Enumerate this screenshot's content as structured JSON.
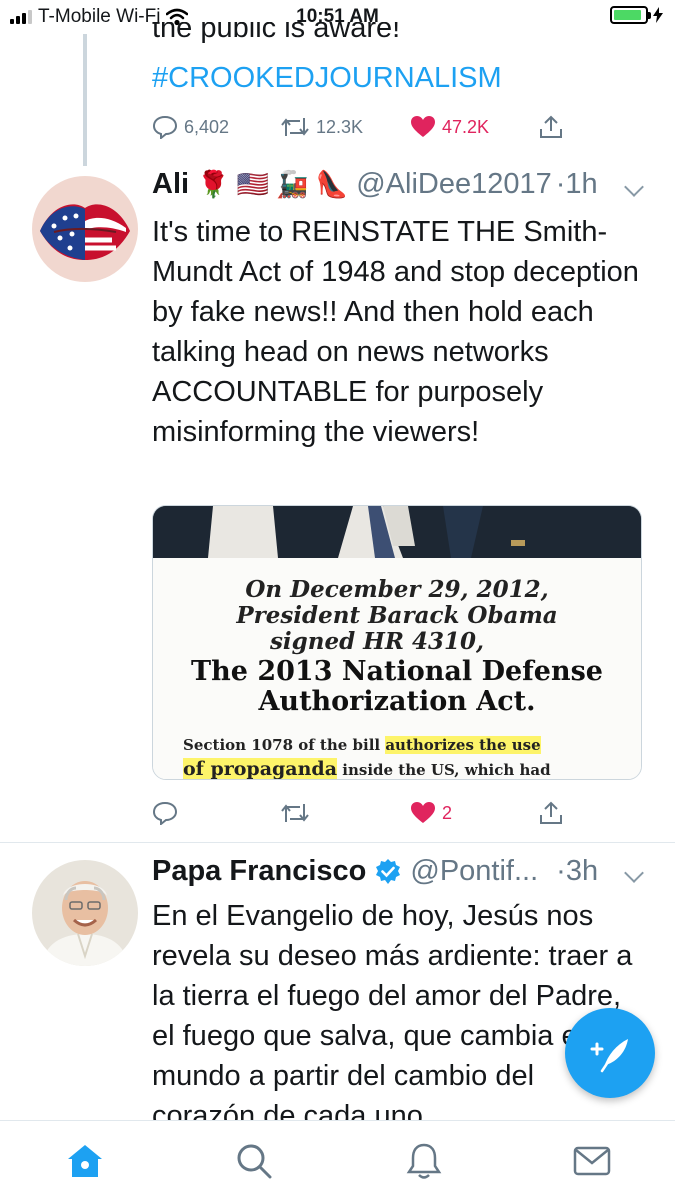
{
  "status_bar": {
    "carrier": "T-Mobile Wi-Fi",
    "time": "10:51 AM",
    "battery_level": 0.9
  },
  "colors": {
    "accent": "#1da1f2",
    "like": "#e0245e",
    "muted": "#657786",
    "text": "#14171a",
    "battery": "#4cd964"
  },
  "tweets": [
    {
      "text_end": "the public is aware!",
      "hashtag": "#CROOKEDJOURNALISM",
      "reply_count": "6,402",
      "retweet_count": "12.3K",
      "like_count": "47.2K",
      "liked": true
    },
    {
      "name": "Ali",
      "name_emoji": "🌹 🇺🇸 🚂 👠",
      "handle": "@AliDee12017",
      "time": "·1h",
      "text": "It's time to REINSTATE THE Smith-Mundt Act of 1948 and stop deception by fake news!! And then hold each talking head on news networks ACCOUNTABLE for purposely misinforming the viewers!",
      "media": {
        "line1": "On December 29, 2012,",
        "line2": "President Barack Obama",
        "line3": "signed HR 4310,",
        "line4": "The 2013 National Defense",
        "line5": "Authorization Act.",
        "section_pre": "Section 1078 of the bill ",
        "section_hl1": "authorizes the use",
        "section_hl2": "of propaganda",
        "section_post": " inside the US, which had"
      },
      "like_count": "2",
      "liked": true
    },
    {
      "name": "Papa Francisco",
      "verified": true,
      "handle": "@Pontif...",
      "time": "·3h",
      "text": "En el Evangelio de hoy, Jesús nos revela su deseo más ardiente: traer a la tierra el fuego del amor del Padre, el fuego que salva, que cambia el mundo a partir del cambio del corazón de cada uno"
    }
  ],
  "tab_bar": [
    "home-icon",
    "search-icon",
    "notifications-icon",
    "messages-icon"
  ],
  "fab_icon": "compose-tweet-icon"
}
